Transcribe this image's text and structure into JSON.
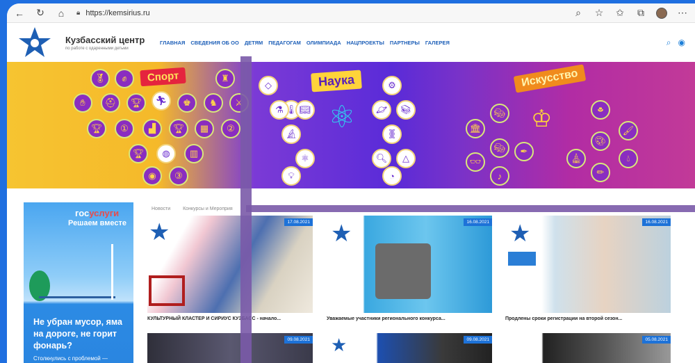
{
  "browser": {
    "url": "https://kemsirius.ru"
  },
  "site": {
    "title": "Кузбасский центр",
    "subtitle": "по работе с одаренными детьми",
    "nav": [
      "ГЛАВНАЯ",
      "СВЕДЕНИЯ ОБ ОО",
      "ДЕТЯМ",
      "ПЕДАГОГАМ",
      "ОЛИМПИАДА",
      "НАЦПРОЕКТЫ",
      "ПАРТНЕРЫ",
      "ГАЛЕРЕЯ"
    ]
  },
  "banner": {
    "sport": "Спорт",
    "science": "Наука",
    "art": "Искусство"
  },
  "promo": {
    "brand_prefix": "гос",
    "brand_suffix": "услуги",
    "tagline": "Решаем вместе",
    "text": "Не убран мусор, яма на дороге, не горит фонарь?",
    "sub": "Столкнулись с проблемой —"
  },
  "breadcrumbs": [
    "Новости",
    "Конкурсы и Мероприя"
  ],
  "cards": [
    {
      "date": "17.08.2021",
      "caption": "КУЛЬТУРНЫЙ КЛАСТЕР И СИРИУС КУЗБАСС - начало..."
    },
    {
      "date": "16.08.2021",
      "caption": "Уважаемые участники регионального конкурса..."
    },
    {
      "date": "16.08.2021",
      "caption": "Продлены сроки регистрации на второй сезон..."
    },
    {
      "date": "09.08.2021",
      "caption": ""
    },
    {
      "date": "09.08.2021",
      "caption": ""
    },
    {
      "date": "05.08.2021",
      "caption": ""
    }
  ],
  "colors": {
    "accent": "#1d72d8",
    "nav": "#1d5fb8",
    "page_bg": "#1f6fe0"
  }
}
